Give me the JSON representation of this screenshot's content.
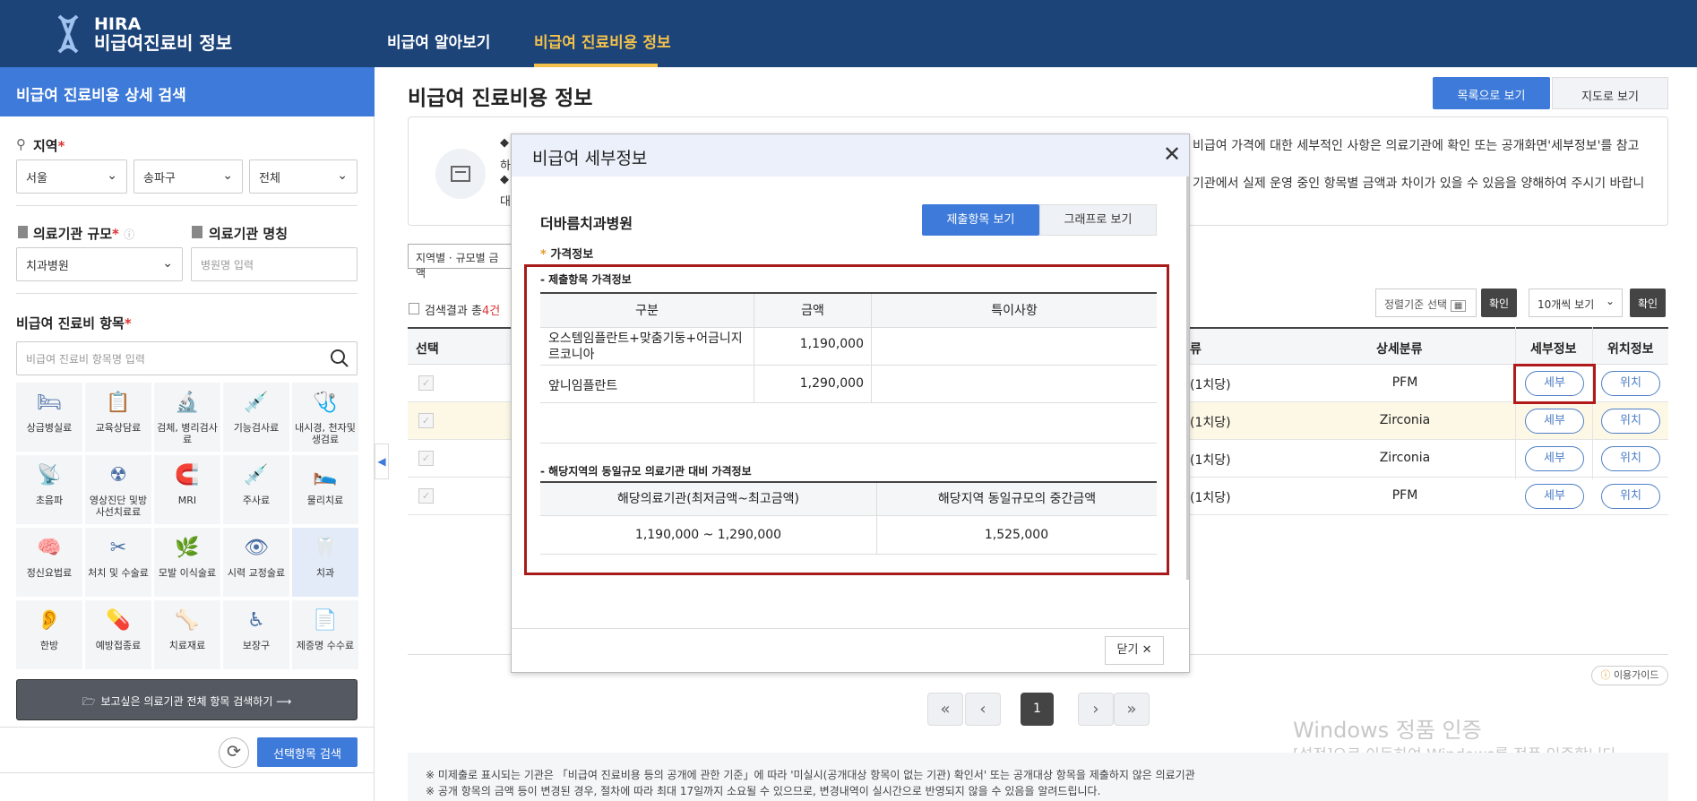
{
  "header": {
    "brand_line1": "HIRA",
    "brand_line2": "비급여진료비 정보",
    "nav": [
      "비급여 알아보기",
      "비급여 진료비용 정보"
    ]
  },
  "sidebar": {
    "title": "비급여 진료비용 상세 검색",
    "region_label": "지역",
    "region_selects": [
      "서울",
      "송파구",
      "전체"
    ],
    "scale_label": "의료기관 규모",
    "scale_value": "치과병원",
    "name_label": "의료기관 명칭",
    "name_placeholder": "병원명 입력",
    "items_label": "비급여 진료비 항목",
    "items_placeholder": "비급여 진료비 항목명 입력",
    "categories": [
      "상급병실료",
      "교육상담료",
      "검체, 병리검사료",
      "기능검사료",
      "내시경, 천자및 생검료",
      "초음파",
      "영상진단 및방사선치료료",
      "MRI",
      "주사료",
      "물리치료",
      "정신요법료",
      "처치 및 수술료",
      "모발 이식술료",
      "시력 교정술료",
      "치과",
      "한방",
      "예방접종료",
      "치료재료",
      "보장구",
      "제증명 수수료"
    ],
    "all_search": "보고싶은 의료기관 전체 항목 검색하기",
    "search_button": "선택항목 검색"
  },
  "main": {
    "title": "비급여 진료비용 정보",
    "view_list": "목록으로 보기",
    "view_map": "지도로 보기",
    "info_lines": [
      "◆",
      "하",
      "◆",
      "대"
    ],
    "info_right1": "비급여 가격에 대한 세부적인 사항은 의료기관에 확인 또는 공개화면'세부정보'를 참고",
    "info_right2": "기관에서 실제 운영 중인 항목별 금액과 차이가 있을 수 있음을 양해하여 주시기 바랍니",
    "region_filter": "지역별 · 규모별 금액",
    "result_prefix": "검색결과 총",
    "result_count": "4건",
    "sort_placeholder": "정렬기준 선택",
    "confirm": "확인",
    "per_page": "10개씩 보기",
    "columns": {
      "select": "선택",
      "category_tail": "류",
      "detail_category": "상세분류",
      "detail_info": "세부정보",
      "location_info": "위치정보"
    },
    "rows": [
      {
        "cat": "(1치당)",
        "detail": "PFM",
        "btn1": "세부",
        "btn2": "위치"
      },
      {
        "cat": "(1치당)",
        "detail": "Zirconia",
        "btn1": "세부",
        "btn2": "위치"
      },
      {
        "cat": "(1치당)",
        "detail": "Zirconia",
        "btn1": "세부",
        "btn2": "위치"
      },
      {
        "cat": "(1치당)",
        "detail": "PFM",
        "btn1": "세부",
        "btn2": "위치"
      }
    ],
    "guide": "이용가이드",
    "current_page": "1",
    "footnotes": [
      "※ 미제출로 표시되는 기관은 「비급여 진료비용 등의 공개에 관한 기준」에 따라 '미실시(공개대상 항목이 없는 기관) 확인서' 또는 공개대상 항목을 제출하지 않은 의료기관",
      "※ 공개 항목의 금액 등이 변경된 경우, 절차에 따라 최대 17일까지 소요될 수 있으므로, 변경내역이 실시간으로 반영되지 않을 수 있음을 알려드립니다."
    ]
  },
  "watermark": {
    "line1": "Windows 정품 인증",
    "line2": "[설정]으로 이동하여 Windows를 정품 인증합니다."
  },
  "modal": {
    "title": "비급여 세부정보",
    "hospital": "더바름치과병원",
    "tab_submitted": "제출항목 보기",
    "tab_graph": "그래프로 보기",
    "price_info": "가격정보",
    "section1": "- 제출항목 가격정보",
    "t1_headers": [
      "구분",
      "금액",
      "특이사항"
    ],
    "t1_rows": [
      {
        "name": "오스템임플란트+맞춤기둥+어금니지르코니아",
        "amount": "1,190,000",
        "note": ""
      },
      {
        "name": "앞니임플란트",
        "amount": "1,290,000",
        "note": ""
      }
    ],
    "section2": "- 해당지역의 동일규모 의료기관 대비 가격정보",
    "t2_headers": [
      "해당의료기관(최저금액~최고금액)",
      "해당지역 동일규모의 중간금액"
    ],
    "t2_row": [
      "1,190,000 ~ 1,290,000",
      "1,525,000"
    ],
    "close": "닫기"
  }
}
